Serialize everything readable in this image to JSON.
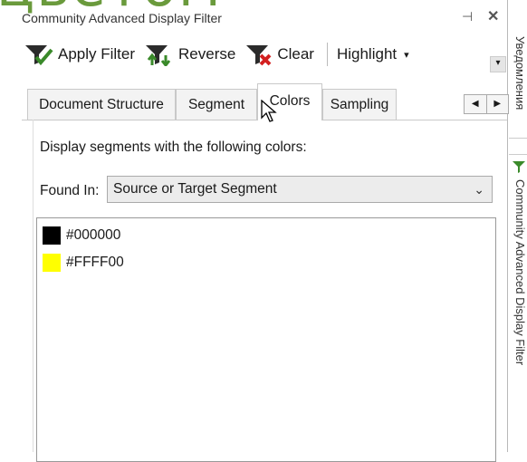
{
  "overlay": {
    "text": "цветом"
  },
  "window": {
    "title": "Community Advanced Display Filter",
    "pin_glyph": "⊣",
    "close_glyph": "✕"
  },
  "toolbar": {
    "apply_label": "Apply Filter",
    "reverse_label": "Reverse",
    "clear_label": "Clear",
    "highlight_label": "Highlight",
    "highlight_caret": "▾",
    "overflow_glyph": "▾"
  },
  "tabs": [
    {
      "label": "Document Structure",
      "active": false
    },
    {
      "label": "Segment",
      "active": false
    },
    {
      "label": "Colors",
      "active": true
    },
    {
      "label": "Sampling",
      "active": false
    }
  ],
  "tab_scroll": {
    "left": "◀",
    "right": "▶"
  },
  "colors_tab": {
    "description": "Display segments with the following colors:",
    "found_in_label": "Found In:",
    "found_in_value": "Source or Target Segment",
    "items": [
      {
        "hex": "#000000",
        "swatch": "#000000"
      },
      {
        "hex": "#FFFF00",
        "swatch": "#FFFF00"
      }
    ]
  },
  "side_strip": {
    "label_top": "Уведомления",
    "label_bottom": "Community Advanced Display Filter"
  },
  "colors": {
    "overlay_green": "#6a9a3c",
    "funnel_dark": "#2b2b2b",
    "funnel_green": "#3a8a2a",
    "clear_red": "#d32020"
  }
}
